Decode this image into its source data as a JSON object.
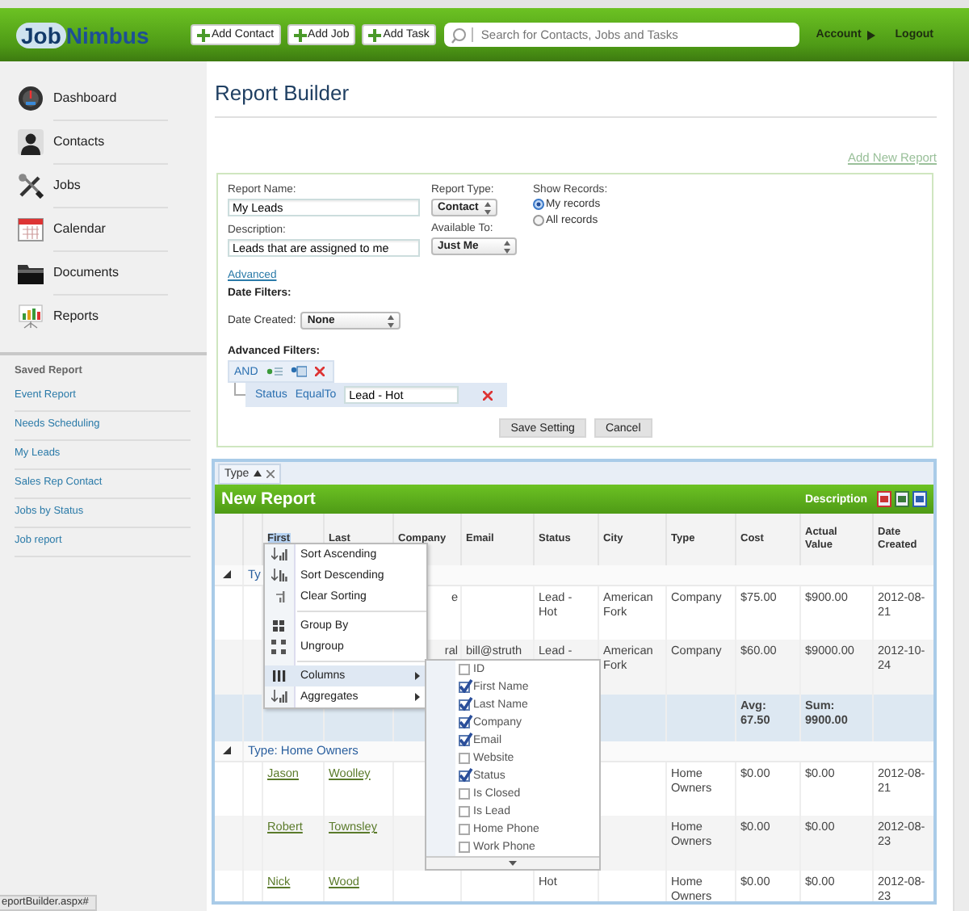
{
  "header": {
    "logo": [
      "Job",
      "Nimbus"
    ],
    "buttons": [
      "Add Contact",
      "Add Job",
      "Add Task"
    ],
    "search": {
      "placeholder": "Search for Contacts, Jobs and Tasks"
    },
    "account": "Account",
    "logout": "Logout"
  },
  "sidebar": {
    "nav": [
      "Dashboard",
      "Contacts",
      "Jobs",
      "Calendar",
      "Documents",
      "Reports"
    ],
    "saved_title": "Saved Report",
    "saved": [
      "Event Report",
      "Needs Scheduling",
      "My Leads",
      "Sales Rep Contact",
      "Jobs by Status",
      "Job report"
    ]
  },
  "page_title": "Report Builder",
  "add_link": "Add New Report",
  "form": {
    "report_name": {
      "label": "Report Name:",
      "value": "My Leads"
    },
    "description": {
      "label": "Description:",
      "value": "Leads that are assigned to me"
    },
    "report_type": {
      "label": "Report Type:",
      "value": "Contact"
    },
    "available_to": {
      "label": "Available To:",
      "value": "Just Me"
    },
    "show_records": {
      "label": "Show Records:",
      "options": [
        {
          "label": "My records",
          "selected": true
        },
        {
          "label": "All records",
          "selected": false
        }
      ]
    },
    "advanced_link": "Advanced",
    "date_filters": {
      "title": "Date Filters:",
      "label": "Date Created:",
      "value": "None"
    },
    "advanced_filters": {
      "title": "Advanced Filters:",
      "operator": "AND",
      "conditions": [
        {
          "field": "Status",
          "op": "EqualTo",
          "value": "Lead - Hot"
        }
      ]
    },
    "buttons": [
      "Save Setting",
      "Cancel"
    ]
  },
  "report_grid": {
    "group_chip": "Type",
    "title": "New Report",
    "description_label": "Description",
    "columns": [
      {
        "label": "First",
        "selected": true
      },
      {
        "label": "Last",
        "selected": false
      },
      {
        "label": "Company",
        "selected": false
      },
      {
        "label": "Email",
        "selected": false
      },
      {
        "label": "Status",
        "selected": false
      },
      {
        "label": "City",
        "selected": false
      },
      {
        "label": "Type",
        "selected": false
      },
      {
        "label": "Cost",
        "selected": false
      },
      {
        "label": "Actual Value",
        "selected": false
      },
      {
        "label": "Date Created",
        "selected": false
      }
    ],
    "rows": [
      {
        "kind": "group",
        "label": "Ty",
        "expanded": true
      },
      {
        "kind": "data",
        "cells": {
          "company": "e",
          "status": "Lead - Hot",
          "city": "American Fork",
          "type": "Company",
          "cost": "$75.00",
          "actual_value": "$900.00",
          "date_created": "2012-08-21"
        }
      },
      {
        "kind": "data",
        "cells": {
          "company": "ral",
          "email": "bill@struth",
          "status": "Lead -",
          "city": "American Fork",
          "type": "Company",
          "cost": "$60.00",
          "actual_value": "$9000.00",
          "date_created": "2012-10-24"
        }
      },
      {
        "kind": "aggregate",
        "cells": {
          "cost": "Avg: 67.50",
          "actual_value": "Sum: 9900.00"
        }
      },
      {
        "kind": "group",
        "label": "Type: Home Owners",
        "expanded": true
      },
      {
        "kind": "data",
        "cells": {
          "first_name": "Jason",
          "last_name": "Woolley",
          "type": "Home Owners",
          "cost": "$0.00",
          "actual_value": "$0.00",
          "date_created": "2012-08-21"
        }
      },
      {
        "kind": "data",
        "cells": {
          "first_name": "Robert",
          "last_name": "Townsley",
          "type": "Home Owners",
          "cost": "$0.00",
          "actual_value": "$0.00",
          "date_created": "2012-08-23"
        }
      },
      {
        "kind": "data",
        "cells": {
          "first_name": "Nick",
          "last_name": "Wood",
          "status": "Hot",
          "type": "Home Owners",
          "cost": "$0.00",
          "actual_value": "$0.00",
          "date_created": "2012-08-23"
        }
      }
    ],
    "column_menu": {
      "groups": [
        [
          {
            "label": "Sort Ascending",
            "selected": false,
            "submenu": false
          },
          {
            "label": "Sort Descending",
            "selected": false,
            "submenu": false
          },
          {
            "label": "Clear Sorting",
            "selected": false,
            "submenu": false
          }
        ],
        [
          {
            "label": "Group By",
            "selected": false,
            "submenu": false
          },
          {
            "label": "Ungroup",
            "selected": false,
            "submenu": false
          }
        ],
        [
          {
            "label": "Columns",
            "selected": true,
            "submenu": true
          },
          {
            "label": "Aggregates",
            "selected": false,
            "submenu": true
          }
        ]
      ]
    },
    "columns_submenu": [
      {
        "label": "ID",
        "checked": false
      },
      {
        "label": "First Name",
        "checked": true
      },
      {
        "label": "Last Name",
        "checked": true
      },
      {
        "label": "Company",
        "checked": true
      },
      {
        "label": "Email",
        "checked": true
      },
      {
        "label": "Website",
        "checked": false
      },
      {
        "label": "Status",
        "checked": true
      },
      {
        "label": "Is Closed",
        "checked": false
      },
      {
        "label": "Is Lead",
        "checked": false
      },
      {
        "label": "Home Phone",
        "checked": false
      },
      {
        "label": "Work Phone",
        "checked": false
      }
    ]
  },
  "status_bar": "eportBuilder.aspx#"
}
